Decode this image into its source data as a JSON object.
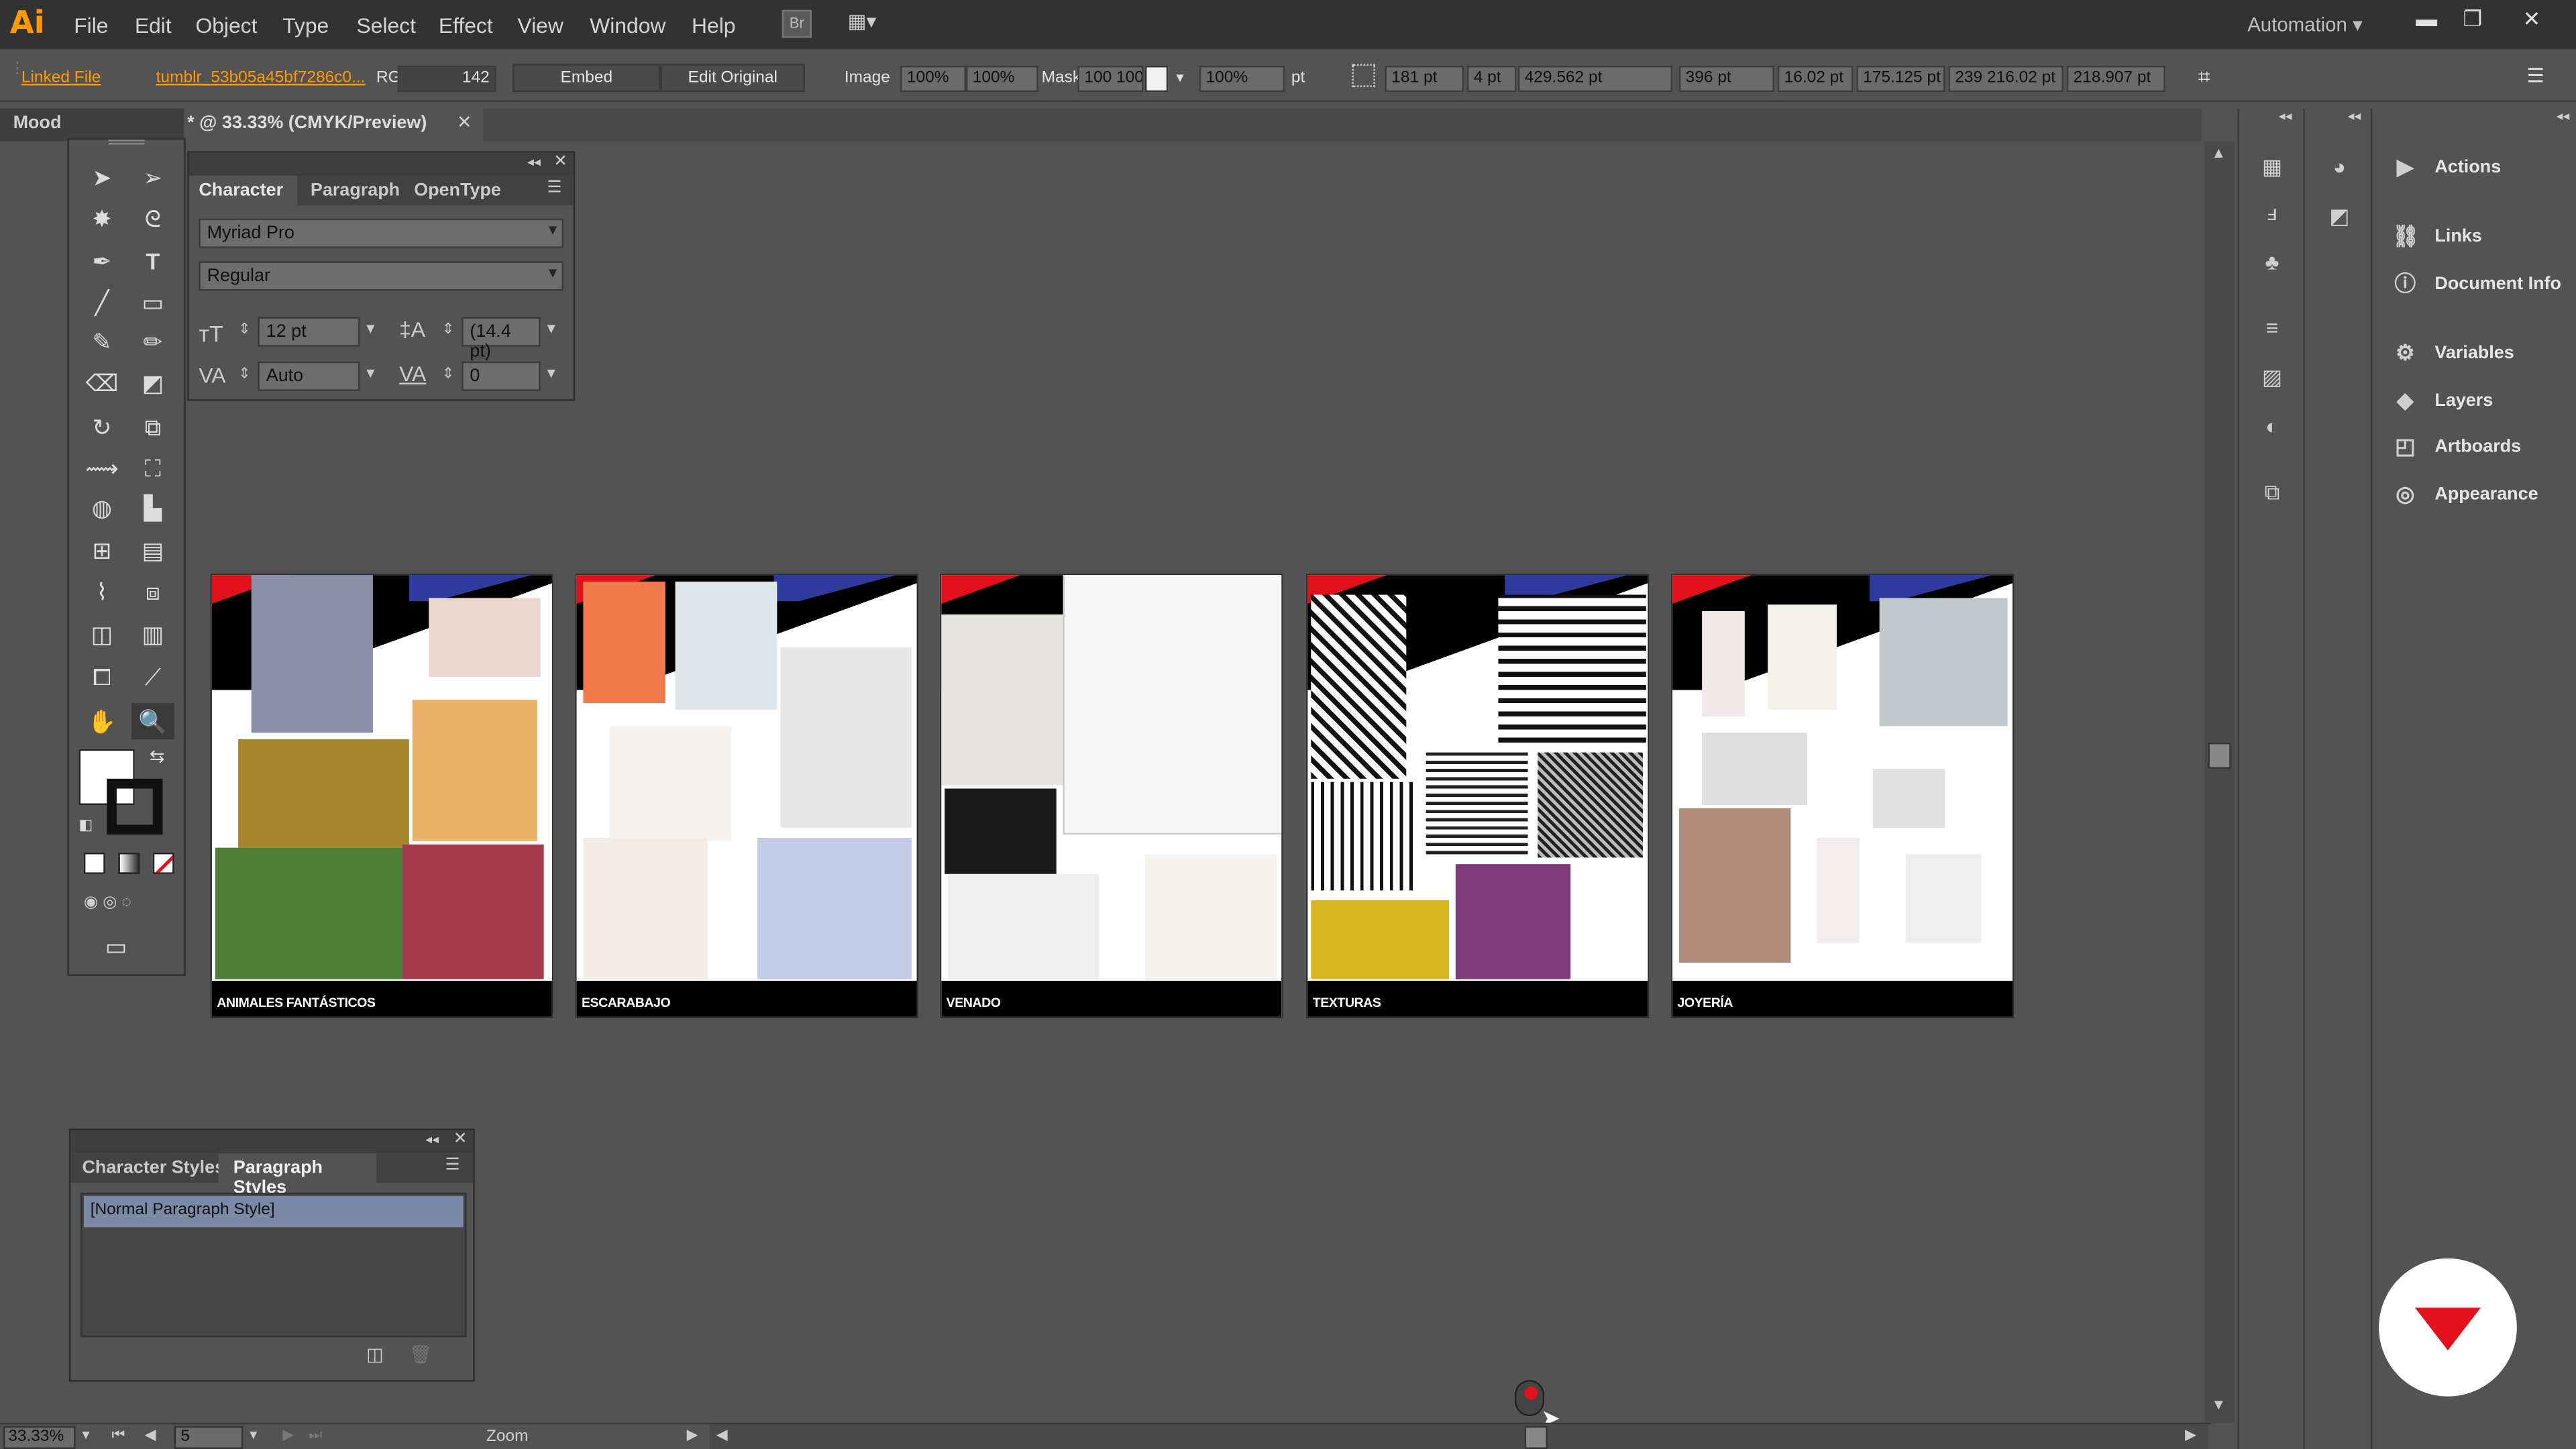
{
  "app": {
    "logo": "Ai"
  },
  "menu": [
    "File",
    "Edit",
    "Object",
    "Type",
    "Select",
    "Effect",
    "View",
    "Window",
    "Help"
  ],
  "bridge_label": "Br",
  "workspace": "Automation",
  "control": {
    "linked_file": "Linked File",
    "file_name": "tumblr_53b05a45bf7286c0...",
    "rgb_label": "RG",
    "ppi": "142",
    "embed": "Embed",
    "edit_original": "Edit Original",
    "image_label": "Image",
    "image_scale_1": "100%",
    "image_scale_2": "100%",
    "mask_label": "Mask",
    "mask_value": "100 100",
    "opacity": "100%",
    "opacity_unit": "pt",
    "x_val": "181 pt",
    "y_val": "4 pt",
    "w_val": "429.562 pt",
    "h_val": "396 pt",
    "extra_1": "16.02 pt",
    "extra_2": "175.125 pt",
    "extra_3": "239 216.02 pt",
    "extra_4": "218.907 pt"
  },
  "doc_tab": {
    "left_label": "Mood",
    "title": "* @ 33.33% (CMYK/Preview)"
  },
  "character_panel": {
    "tabs": [
      "Character",
      "Paragraph",
      "OpenType"
    ],
    "font_family": "Myriad Pro",
    "font_style": "Regular",
    "size": "12 pt",
    "leading": "(14.4 pt)",
    "kerning": "Auto",
    "tracking": "0"
  },
  "styles_panel": {
    "tabs": [
      "Character Styles",
      "Paragraph Styles"
    ],
    "item": "[Normal Paragraph Style]"
  },
  "artboards": [
    {
      "label": "ANIMALES FANTÁSTICOS"
    },
    {
      "label": "ESCARABAJO"
    },
    {
      "label": "VENADO"
    },
    {
      "label": "TEXTURAS"
    },
    {
      "label": "JOYERÍA"
    }
  ],
  "right_panel": [
    "Actions",
    "Links",
    "Document Info",
    "Variables",
    "Layers",
    "Artboards",
    "Appearance"
  ],
  "status": {
    "zoom": "33.33%",
    "artboard_num": "5",
    "mode": "Zoom"
  },
  "colors": {
    "brand_red": "#e3111b",
    "accent_orange": "#ff9a00",
    "accent_blue": "#2e3a9c"
  }
}
